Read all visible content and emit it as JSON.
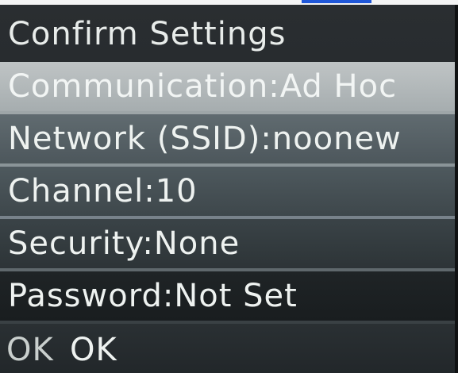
{
  "screen": {
    "title": "Confirm Settings",
    "rows": [
      {
        "text": "Communication:Ad Hoc"
      },
      {
        "text": "Network (SSID):noonew"
      },
      {
        "text": "Channel:10"
      },
      {
        "text": "Security:None"
      },
      {
        "text": "Password:Not Set"
      }
    ]
  },
  "softkeys": {
    "ok_key_glyph": "OK",
    "ok_label": "OK"
  },
  "colors": {
    "screen_bg": "#23272a",
    "selected_row_bg": "#b2b8ba",
    "text": "#eef2f0"
  }
}
